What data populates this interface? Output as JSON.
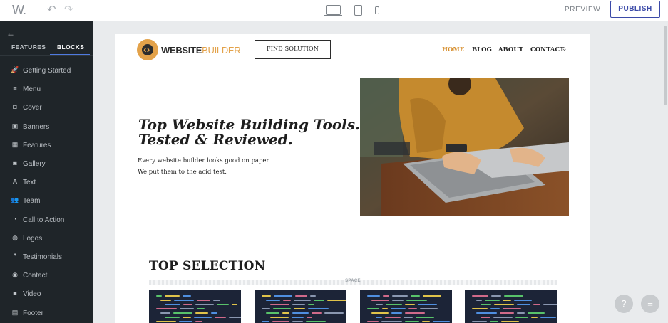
{
  "topbar": {
    "logo": "W.",
    "undo_icon": "↶",
    "redo_icon": "↷",
    "preview_label": "PREVIEW",
    "publish_label": "PUBLISH"
  },
  "sidebar": {
    "back_icon": "←",
    "tabs": [
      {
        "label": "FEATURES",
        "active": false
      },
      {
        "label": "BLOCKS",
        "active": true
      }
    ],
    "items": [
      {
        "icon": "rocket-icon",
        "glyph": "🚀",
        "label": "Getting Started"
      },
      {
        "icon": "menu-icon",
        "glyph": "≡",
        "label": "Menu"
      },
      {
        "icon": "cover-icon",
        "glyph": "◘",
        "label": "Cover"
      },
      {
        "icon": "banner-icon",
        "glyph": "▣",
        "label": "Banners"
      },
      {
        "icon": "features-icon",
        "glyph": "▦",
        "label": "Features"
      },
      {
        "icon": "camera-icon",
        "glyph": "◙",
        "label": "Gallery"
      },
      {
        "icon": "text-icon",
        "glyph": "A",
        "label": "Text"
      },
      {
        "icon": "team-icon",
        "glyph": "👥",
        "label": "Team"
      },
      {
        "icon": "cta-icon",
        "glyph": "◔",
        "label": "Call to Action"
      },
      {
        "icon": "logos-icon",
        "glyph": "◍",
        "label": "Logos"
      },
      {
        "icon": "quote-icon",
        "glyph": "❞",
        "label": "Testimonials"
      },
      {
        "icon": "location-icon",
        "glyph": "◉",
        "label": "Contact"
      },
      {
        "icon": "video-icon",
        "glyph": "■",
        "label": "Video"
      },
      {
        "icon": "footer-icon",
        "glyph": "▤",
        "label": "Footer"
      }
    ]
  },
  "site": {
    "brand_bold": "WEBSITE",
    "brand_light": "BUILDER",
    "find_button": "FIND SOLUTION",
    "nav": {
      "home": "HOME",
      "blog": "BLOG",
      "about": "ABOUT",
      "contact": "CONTACT"
    },
    "hero_line1": "Top Website Building Tools.",
    "hero_line2": "Tested & Reviewed.",
    "hero_sub1": "Every website builder looks good on paper.",
    "hero_sub2": "We put them to the acid test.",
    "section_title": "TOP SELECTION",
    "space_label": "SPACE"
  },
  "colors": {
    "accent": "#e3a24a",
    "publish": "#3b4aa8",
    "sidebar_bg": "#1f2529"
  },
  "fabs": {
    "help": "?",
    "chat": "≡"
  }
}
